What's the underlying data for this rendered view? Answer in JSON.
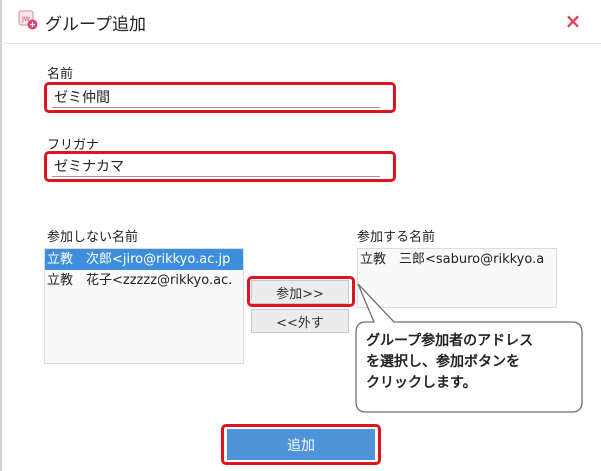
{
  "dialog": {
    "title": "グループ追加",
    "title_icon": "group-add-icon",
    "close_icon": "close-icon",
    "close_glyph": "×"
  },
  "form": {
    "name_label": "名前",
    "name_value": "ゼミ仲間",
    "kana_label": "フリガナ",
    "kana_value": "ゼミナカマ"
  },
  "lists": {
    "not_members_label": "参加しない名前",
    "not_members": [
      {
        "text": "立教　次郎<jiro@rikkyo.ac.jp",
        "selected": true
      },
      {
        "text": "立教　花子<zzzzz@rikkyo.ac.",
        "selected": false
      }
    ],
    "members_label": "参加する名前",
    "members": [
      {
        "text": "立教　三郎<saburo@rikkyo.a",
        "selected": false
      }
    ]
  },
  "buttons": {
    "join": "参加>>",
    "remove": "<<外す",
    "submit": "追加"
  },
  "callout": {
    "line1": "グループ参加者のアドレス",
    "line2": "を選択し、参加ボタンを",
    "line3": "クリックします。"
  },
  "colors": {
    "highlight": "#e0141e",
    "selected_row": "#3d8fde",
    "submit_button": "#4f93d9",
    "close_icon": "#d9485f"
  }
}
